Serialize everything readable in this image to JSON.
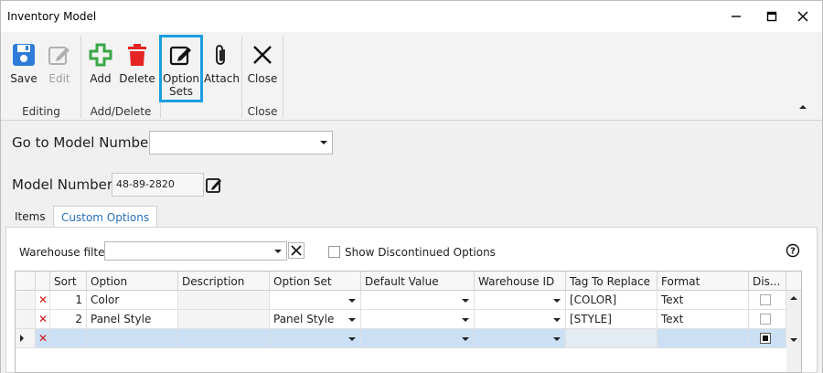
{
  "window": {
    "title": "Inventory Model"
  },
  "ribbon": {
    "groups": [
      {
        "label": "Editing"
      },
      {
        "label": "Add/Delete"
      },
      {
        "label": "Close"
      }
    ],
    "buttons": {
      "save": "Save",
      "edit": "Edit",
      "add": "Add",
      "delete": "Delete",
      "option_sets_line1": "Option",
      "option_sets_line2": "Sets",
      "attach": "Attach",
      "close": "Close"
    }
  },
  "form": {
    "goto_label": "Go to Model Number:",
    "goto_value": "",
    "model_label": "Model Number:",
    "model_value": "48-89-2820"
  },
  "tabs": [
    {
      "label": "Items"
    },
    {
      "label": "Custom Options"
    }
  ],
  "custom_options": {
    "warehouse_filter_label": "Warehouse filter:",
    "warehouse_filter_value": "",
    "show_discontinued_label": "Show Discontinued Options",
    "show_discontinued_checked": false,
    "columns": [
      "Sort",
      "Option",
      "Description",
      "Option Set",
      "Default Value",
      "Warehouse ID",
      "Tag To Replace",
      "Format",
      "Dis..."
    ],
    "rows": [
      {
        "sort": "1",
        "option": "Color",
        "description": "",
        "option_set": "",
        "default_value": "",
        "warehouse_id": "",
        "tag": "[COLOR]",
        "format": "Text",
        "discontinued": false
      },
      {
        "sort": "2",
        "option": "Panel Style",
        "description": "",
        "option_set": "Panel Style",
        "default_value": "",
        "warehouse_id": "",
        "tag": "[STYLE]",
        "format": "Text",
        "discontinued": false
      }
    ],
    "new_row": {
      "discontinued": true
    }
  },
  "colors": {
    "accent": "#1b9ee0",
    "save_blue": "#2f7bd8",
    "add_green": "#3aa845",
    "delete_red": "#e52424",
    "new_row": "#cbe0f4"
  }
}
